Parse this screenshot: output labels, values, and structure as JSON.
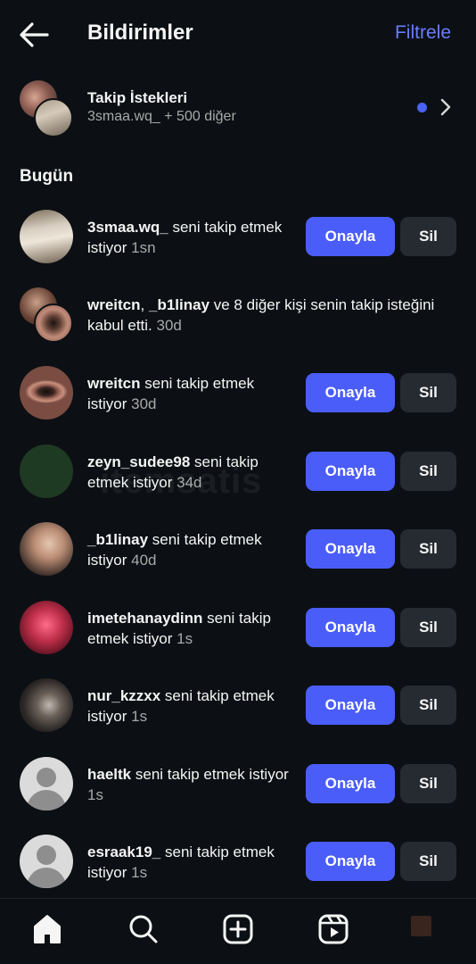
{
  "header": {
    "title": "Bildirimler",
    "filter_label": "Filtrele"
  },
  "follow_requests": {
    "title": "Takip İstekleri",
    "subtitle": "3smaa.wq_ + 500 diğer"
  },
  "section": {
    "today": "Bugün"
  },
  "buttons": {
    "approve": "Onayla",
    "delete": "Sil"
  },
  "notifications": [
    {
      "user": "3smaa.wq_",
      "text": " seni takip etmek istiyor ",
      "time": "1sn"
    },
    {
      "user": "wreitcn",
      "sep": ", ",
      "user2": "_b1linay",
      "text": " ve 8 diğer kişi senin takip isteğini kabul etti. ",
      "time": "30d"
    },
    {
      "user": "wreitcn",
      "text": " seni takip etmek istiyor ",
      "time": "30d"
    },
    {
      "user": "zeyn_sudee98",
      "text": " seni takip etmek istiyor ",
      "time": "34d"
    },
    {
      "user": "_b1linay",
      "text": " seni takip etmek istiyor ",
      "time": "40d"
    },
    {
      "user": "imetehanaydinn",
      "text": " seni takip etmek istiyor ",
      "time": "1s"
    },
    {
      "user": "nur_kzzxx",
      "text": " seni takip etmek istiyor ",
      "time": "1s"
    },
    {
      "user": "haeltk",
      "text": " seni takip etmek istiyor ",
      "time": "1s"
    },
    {
      "user": "esraak19_",
      "text": " seni takip etmek istiyor ",
      "time": "1s"
    }
  ],
  "watermark": "itemsatis",
  "colors": {
    "background": "#0c1014",
    "accent": "#4a5df9",
    "filter": "#6b7cff",
    "secondary_button": "#262a31"
  },
  "icons": {
    "back": "arrow-left-icon",
    "chevron": "chevron-right-icon",
    "home": "home-icon",
    "search": "search-icon",
    "create": "plus-square-icon",
    "reels": "reels-icon"
  }
}
